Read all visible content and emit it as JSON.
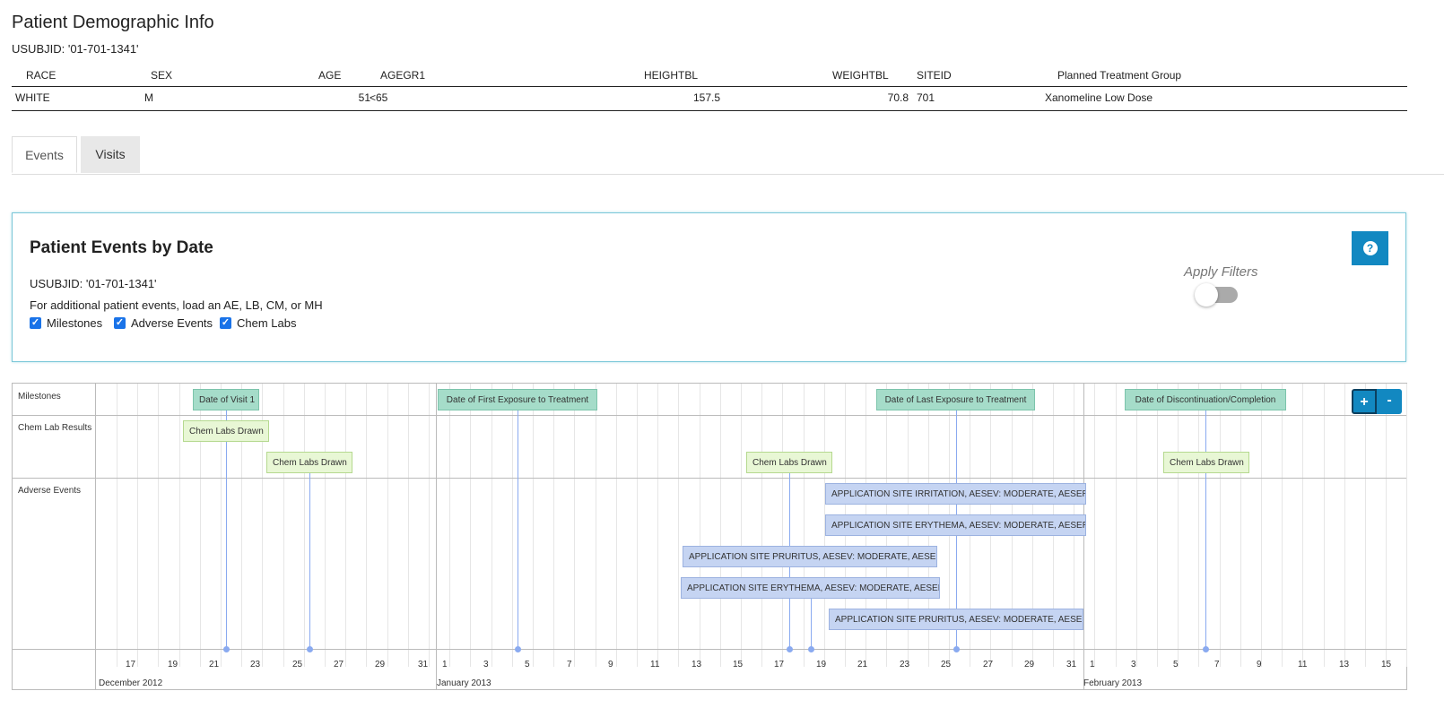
{
  "page": {
    "title": "Patient Demographic Info",
    "usubjid": "USUBJID: '01-701-1341'"
  },
  "demographics": {
    "headers": [
      "RACE",
      "SEX",
      "AGE",
      "AGEGR1",
      "HEIGHTBL",
      "WEIGHTBL",
      "SITEID",
      "Planned Treatment Group"
    ],
    "row": [
      "WHITE",
      "M",
      "51",
      "<65",
      "157.5",
      "70.8",
      "701",
      "Xanomeline Low Dose"
    ]
  },
  "tabs": [
    "Events",
    "Visits"
  ],
  "panel": {
    "title": "Patient Events by Date",
    "usubjid": "USUBJID: '01-701-1341'",
    "hint": "For additional patient events, load an AE, LB, CM, or MH",
    "checkboxes": [
      "Milestones",
      "Adverse Events",
      "Chem Labs"
    ],
    "apply_filters": "Apply Filters",
    "apply_filters_on": false,
    "help_icon": "question-circle-icon"
  },
  "timeline": {
    "groups": [
      "Milestones",
      "Chem Lab Results",
      "Adverse Events"
    ],
    "milestones": [
      "Date of Visit 1",
      "Date of First Exposure to Treatment",
      "Date of Last Exposure to Treatment",
      "Date of Discontinuation/Completion"
    ],
    "chem_labs": [
      "Chem Labs Drawn",
      "Chem Labs Drawn",
      "Chem Labs Drawn",
      "Chem Labs Drawn"
    ],
    "adverse_events": [
      "APPLICATION SITE IRRITATION, AESEV: MODERATE, AESER: N",
      "APPLICATION SITE ERYTHEMA, AESEV: MODERATE, AESER: N",
      "APPLICATION SITE PRURITUS, AESEV: MODERATE, AESER: N",
      "APPLICATION SITE ERYTHEMA, AESEV: MODERATE, AESER: N",
      "APPLICATION SITE PRURITUS, AESEV: MODERATE, AESER: N"
    ],
    "ticks": [
      "17",
      "19",
      "21",
      "23",
      "25",
      "27",
      "29",
      "31",
      "1",
      "3",
      "5",
      "7",
      "9",
      "11",
      "13",
      "15",
      "17",
      "19",
      "21",
      "23",
      "25",
      "27",
      "29",
      "31",
      "1",
      "3",
      "5",
      "7",
      "9",
      "11",
      "13",
      "15"
    ],
    "months": [
      "December 2012",
      "January 2013",
      "February 2013"
    ],
    "zoom_in": "+",
    "zoom_out": "-"
  }
}
